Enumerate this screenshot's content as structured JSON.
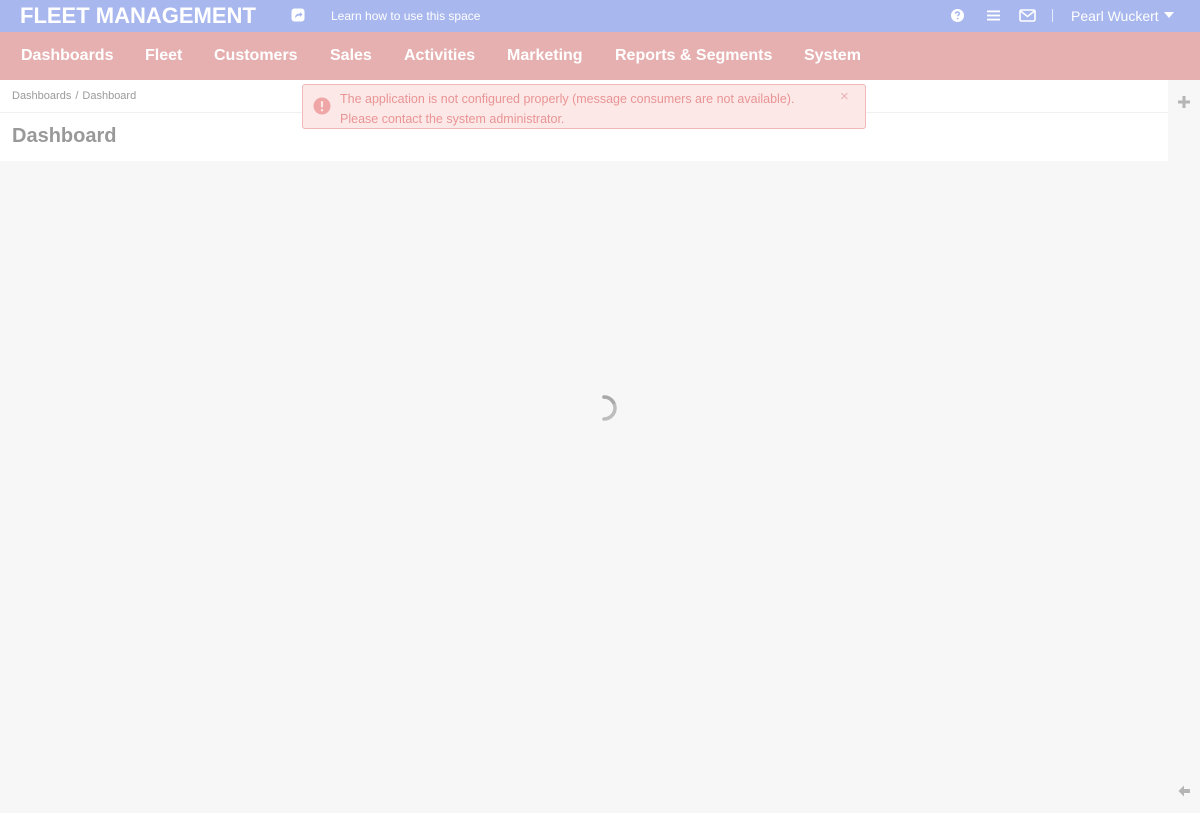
{
  "app": {
    "brand": "FLEET MANAGEMENT",
    "help_link": "Learn how to use this space",
    "user_name": "Pearl Wuckert",
    "icons": {
      "share": "share-icon",
      "help": "question-circle-icon",
      "tasks": "list-icon",
      "mail": "envelope-icon",
      "add": "plus-icon",
      "collapse": "arrow-left-icon",
      "alert": "exclamation-circle-icon",
      "close": "close-icon"
    }
  },
  "nav": {
    "items": [
      "Dashboards",
      "Fleet",
      "Customers",
      "Sales",
      "Activities",
      "Marketing",
      "Reports & Segments",
      "System"
    ]
  },
  "page": {
    "breadcrumb": [
      "Dashboards",
      "Dashboard"
    ],
    "breadcrumb_separator": "/",
    "title": "Dashboard"
  },
  "alert": {
    "line1": "The application is not configured properly (message consumers are not available).",
    "line2": "Please contact the system administrator.",
    "close": "×"
  },
  "colors": {
    "topbar": "#a8b7ee",
    "navbar": "#e6b0b0",
    "alert_bg": "#fde8e8",
    "alert_text": "#e99494",
    "content_bg": "#f7f7f7"
  }
}
